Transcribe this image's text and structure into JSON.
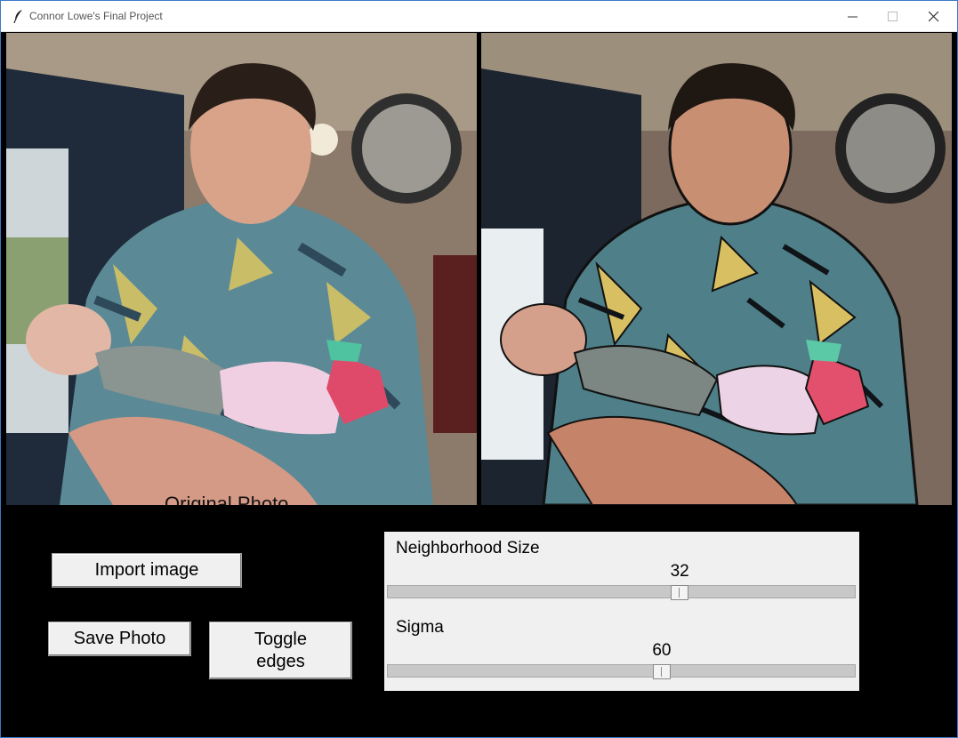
{
  "window": {
    "title": "Connor Lowe's Final Project"
  },
  "photos": {
    "original_caption": "Original Photo",
    "processed_label": ""
  },
  "buttons": {
    "import": "Import image",
    "save": "Save Photo",
    "toggle_edges": "Toggle\n edges"
  },
  "sliders": {
    "neighborhood": {
      "label": "Neighborhood Size",
      "value": "32",
      "fraction": 0.63
    },
    "sigma": {
      "label": "Sigma",
      "value": "60",
      "fraction": 0.59
    }
  },
  "icons": [
    "feather-icon",
    "minimize-icon",
    "maximize-icon",
    "close-icon"
  ]
}
